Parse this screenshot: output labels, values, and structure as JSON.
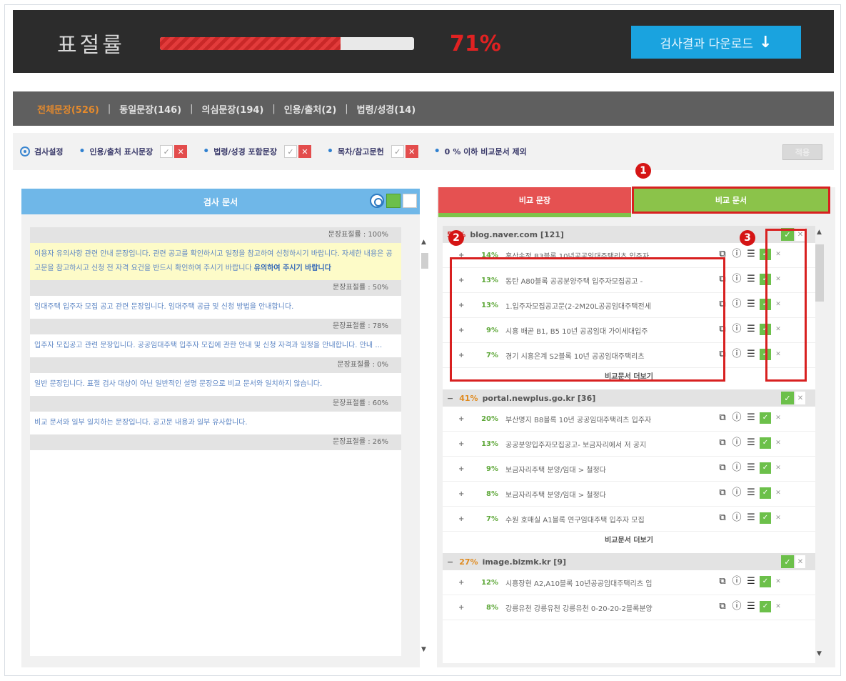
{
  "header": {
    "title": "표절률",
    "progress": 0.71,
    "percent": "71%",
    "download_label": "검사결과 다운로드"
  },
  "categories": [
    {
      "label": "전체문장(526)",
      "active": true
    },
    {
      "label": "동일문장(146)",
      "active": false
    },
    {
      "label": "의심문장(194)",
      "active": false
    },
    {
      "label": "인용/출처(2)",
      "active": false
    },
    {
      "label": "법령/성경(14)",
      "active": false
    }
  ],
  "settings": {
    "label": "검사설정",
    "opt1": "인용/출처 표시문장",
    "opt2": "법령/성경 포함문장",
    "opt3": "목차/참고문헌",
    "threshold": "0",
    "opt4": "% 이하 비교문서 제외",
    "apply": "적용"
  },
  "left_panel": {
    "title": "검사 문서",
    "sections": [
      {
        "header": "문장표절률 : 100%",
        "text": "이용자 유의사항 관련 안내 문장입니다. 관련 공고를 확인하시고 일정을 참고하여 신청하시기 바랍니다. 자세한 내용은 공고문을 참고하시고 신청 전 자격 요건을 반드시 확인하여 주시기 바랍니다",
        "highlight": "유의하여 주시기 바랍니다",
        "yellow": true
      },
      {
        "header": "문장표절률 : 50%",
        "text": "임대주택 입주자 모집 공고 관련 문장입니다. 임대주택 공급 및 신청 방법을 안내합니다.",
        "highlight": "",
        "yellow": false
      },
      {
        "header": "문장표절률 : 78%",
        "text": "입주자 모집공고 관련 문장입니다. 공공임대주택 입주자 모집에 관한 안내 및 신청 자격과 일정을 안내합니다. 안내 …",
        "highlight": "",
        "yellow": false
      },
      {
        "header": "문장표절률 : 0%",
        "text": "일반 문장입니다. 표절 검사 대상이 아닌 일반적인 설명 문장으로 비교 문서와 일치하지 않습니다.",
        "highlight": "",
        "yellow": false
      },
      {
        "header": "문장표절률 : 60%",
        "text": "비교 문서와 일부 일치하는 문장입니다. 공고문 내용과 일부 유사합니다.",
        "highlight": "",
        "yellow": false
      },
      {
        "header": "문장표절률 : 26%",
        "text": "",
        "highlight": "",
        "yellow": false
      }
    ]
  },
  "right_panel": {
    "tab_sentence": "비교 문장",
    "tab_document": "비교 문서",
    "more_label": "비교문서 더보기",
    "groups": [
      {
        "percent": "55%",
        "source": "blog.naver.com [121]",
        "items": [
          {
            "percent": "14%",
            "title": "홍산송정 B3블록 10년공공임대주택리츠 입주자"
          },
          {
            "percent": "13%",
            "title": "동탄 A80블록 공공분양주택 입주자모집공고 -"
          },
          {
            "percent": "13%",
            "title": "1.입주자모집공고문(2-2M20L공공임대주택전세"
          },
          {
            "percent": "9%",
            "title": "시흥 배곧 B1, B5 10년 공공임대 가이세대입주"
          },
          {
            "percent": "7%",
            "title": "경기 시흥은계 S2블록 10년 공공임대주택리츠"
          }
        ],
        "more": true
      },
      {
        "percent": "41%",
        "source": "portal.newplus.go.kr [36]",
        "items": [
          {
            "percent": "20%",
            "title": "부산명지 B8블록 10년 공공임대주택리츠 입주자"
          },
          {
            "percent": "13%",
            "title": "공공분양입주자모집공고- 보금자리에서 저 공지"
          },
          {
            "percent": "9%",
            "title": "보금자리주택 분양/임대 > 철정다"
          },
          {
            "percent": "8%",
            "title": "보금자리주택 분양/임대 > 철정다"
          },
          {
            "percent": "7%",
            "title": "수원 호매실 A1블록 연구임대주택 입주자 모집"
          }
        ],
        "more": true
      },
      {
        "percent": "27%",
        "source": "image.bizmk.kr [9]",
        "items": [
          {
            "percent": "12%",
            "title": "시흥장현 A2,A10블록 10년공공임대주택리츠 입"
          },
          {
            "percent": "8%",
            "title": "강릉유천 강릉유천 강릉유천 0-20-20-2블록분양"
          }
        ],
        "more": false
      }
    ]
  },
  "badges": [
    "1",
    "2",
    "3"
  ],
  "colors": {
    "accent_red": "#e02222",
    "download_blue": "#1aa3df",
    "green": "#8bc34a",
    "highlight_box": "#d82020"
  }
}
